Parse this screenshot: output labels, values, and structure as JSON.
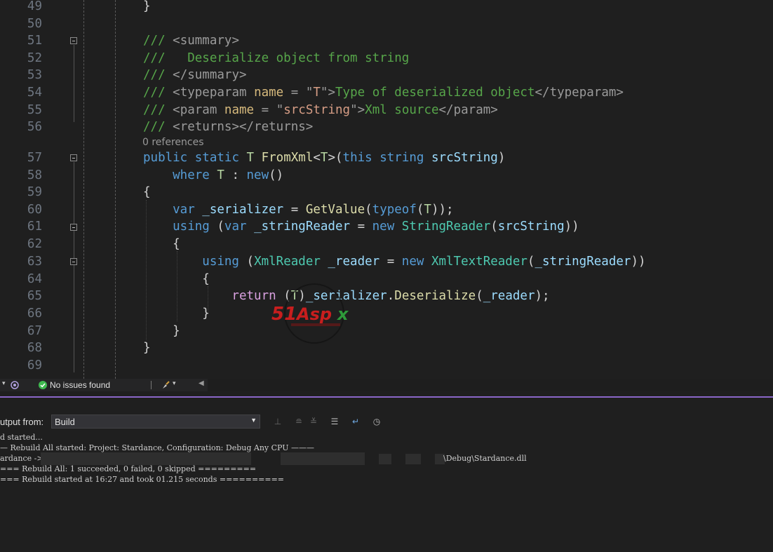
{
  "editor": {
    "line_numbers": [
      "49",
      "50",
      "51",
      "52",
      "53",
      "54",
      "55",
      "56",
      "57",
      "58",
      "59",
      "60",
      "61",
      "62",
      "63",
      "64",
      "65",
      "66",
      "67",
      "68",
      "69"
    ],
    "codelens": "0 references",
    "lines": [
      [
        {
          "t": "}",
          "c": "pun"
        }
      ],
      [],
      [
        {
          "t": "/// ",
          "c": "com"
        },
        {
          "t": "<summary>",
          "c": "xml"
        }
      ],
      [
        {
          "t": "///   Deserialize object from string",
          "c": "com"
        }
      ],
      [
        {
          "t": "/// ",
          "c": "com"
        },
        {
          "t": "</summary>",
          "c": "xml"
        }
      ],
      [
        {
          "t": "/// ",
          "c": "com"
        },
        {
          "t": "<typeparam ",
          "c": "xml"
        },
        {
          "t": "name",
          "c": "attr"
        },
        {
          "t": " = ",
          "c": "xml"
        },
        {
          "t": "\"",
          "c": "xml"
        },
        {
          "t": "T",
          "c": "str"
        },
        {
          "t": "\"",
          "c": "xml"
        },
        {
          "t": ">",
          "c": "xml"
        },
        {
          "t": "Type of deserialized object",
          "c": "com"
        },
        {
          "t": "</typeparam>",
          "c": "xml"
        }
      ],
      [
        {
          "t": "/// ",
          "c": "com"
        },
        {
          "t": "<param ",
          "c": "xml"
        },
        {
          "t": "name",
          "c": "attr"
        },
        {
          "t": " = ",
          "c": "xml"
        },
        {
          "t": "\"",
          "c": "xml"
        },
        {
          "t": "srcString",
          "c": "str"
        },
        {
          "t": "\"",
          "c": "xml"
        },
        {
          "t": ">",
          "c": "xml"
        },
        {
          "t": "Xml source",
          "c": "com"
        },
        {
          "t": "</param>",
          "c": "xml"
        }
      ],
      [
        {
          "t": "/// ",
          "c": "com"
        },
        {
          "t": "<returns></returns>",
          "c": "xml"
        }
      ],
      [
        {
          "t": "public ",
          "c": "kw"
        },
        {
          "t": "static ",
          "c": "kw"
        },
        {
          "t": "T ",
          "c": "tp"
        },
        {
          "t": "FromXml",
          "c": "meth"
        },
        {
          "t": "<",
          "c": "pun"
        },
        {
          "t": "T",
          "c": "tp"
        },
        {
          "t": ">(",
          "c": "pun"
        },
        {
          "t": "this ",
          "c": "kw"
        },
        {
          "t": "string ",
          "c": "kw"
        },
        {
          "t": "srcString",
          "c": "var"
        },
        {
          "t": ")",
          "c": "pun"
        }
      ],
      [
        {
          "t": "    where ",
          "c": "kw"
        },
        {
          "t": "T",
          "c": "tp"
        },
        {
          "t": " : ",
          "c": "pun"
        },
        {
          "t": "new",
          "c": "kw"
        },
        {
          "t": "()",
          "c": "pun"
        }
      ],
      [
        {
          "t": "{",
          "c": "pun"
        }
      ],
      [
        {
          "t": "    var ",
          "c": "kw"
        },
        {
          "t": "_serializer",
          "c": "var"
        },
        {
          "t": " = ",
          "c": "pun"
        },
        {
          "t": "GetValue",
          "c": "meth"
        },
        {
          "t": "(",
          "c": "pun"
        },
        {
          "t": "typeof",
          "c": "kw"
        },
        {
          "t": "(",
          "c": "pun"
        },
        {
          "t": "T",
          "c": "tp"
        },
        {
          "t": "));",
          "c": "pun"
        }
      ],
      [
        {
          "t": "    using ",
          "c": "kw"
        },
        {
          "t": "(",
          "c": "pun"
        },
        {
          "t": "var ",
          "c": "kw"
        },
        {
          "t": "_stringReader",
          "c": "var"
        },
        {
          "t": " = ",
          "c": "pun"
        },
        {
          "t": "new ",
          "c": "kw"
        },
        {
          "t": "StringReader",
          "c": "type"
        },
        {
          "t": "(",
          "c": "pun"
        },
        {
          "t": "srcString",
          "c": "var"
        },
        {
          "t": "))",
          "c": "pun"
        }
      ],
      [
        {
          "t": "    {",
          "c": "pun"
        }
      ],
      [
        {
          "t": "        using ",
          "c": "kw"
        },
        {
          "t": "(",
          "c": "pun"
        },
        {
          "t": "XmlReader ",
          "c": "type"
        },
        {
          "t": "_reader",
          "c": "var"
        },
        {
          "t": " = ",
          "c": "pun"
        },
        {
          "t": "new ",
          "c": "kw"
        },
        {
          "t": "XmlTextReader",
          "c": "type"
        },
        {
          "t": "(",
          "c": "pun"
        },
        {
          "t": "_stringReader",
          "c": "var"
        },
        {
          "t": "))",
          "c": "pun"
        }
      ],
      [
        {
          "t": "        {",
          "c": "pun"
        }
      ],
      [
        {
          "t": "            return ",
          "c": "ctl"
        },
        {
          "t": "(",
          "c": "pun"
        },
        {
          "t": "T",
          "c": "tp"
        },
        {
          "t": ")",
          "c": "pun"
        },
        {
          "t": "_serializer",
          "c": "var"
        },
        {
          "t": ".",
          "c": "pun"
        },
        {
          "t": "Deserialize",
          "c": "meth"
        },
        {
          "t": "(",
          "c": "pun"
        },
        {
          "t": "_reader",
          "c": "var"
        },
        {
          "t": ");",
          "c": "pun"
        }
      ],
      [
        {
          "t": "        }",
          "c": "pun"
        }
      ],
      [
        {
          "t": "    }",
          "c": "pun"
        }
      ],
      [
        {
          "t": "}",
          "c": "pun"
        }
      ],
      []
    ]
  },
  "watermark": {
    "text": "51Aspx"
  },
  "statusbar": {
    "issues_label": "No issues found"
  },
  "output": {
    "from_label": "utput from:",
    "source_value": "Build",
    "lines": [
      "d started...",
      "— Rebuild All started: Project: Stardance, Configuration: Debug Any CPU ———",
      "ardance ->",
      "\\Debug\\Stardance.dll",
      "=== Rebuild All: 1 succeeded, 0 failed, 0 skipped =========",
      "=== Rebuild started at 16:27 and took 01.215 seconds =========="
    ]
  },
  "colors": {
    "accent": "#8a66c8",
    "editor_bg": "#1f1f1f",
    "check_green": "#3fb950"
  }
}
